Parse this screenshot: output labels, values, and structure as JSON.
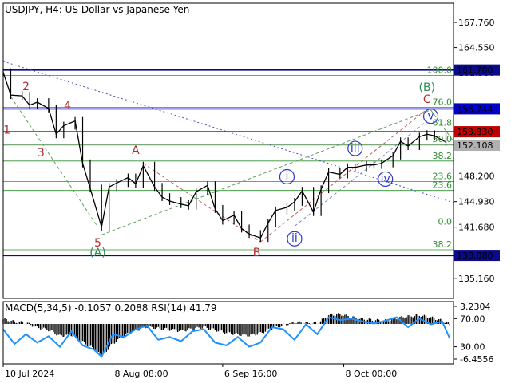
{
  "chart_data": {
    "type": "line",
    "title": "USDJPY, H4:  US Dollar vs Japanese Yen",
    "symbol": "USDJPY",
    "timeframe": "H4",
    "instrument": "US Dollar vs Japanese Yen",
    "price_axis": {
      "ylim": [
        132.6,
        170.2
      ],
      "ticks": [
        "167.760",
        "164.550",
        "161.700",
        "156.744",
        "153.830",
        "152.108",
        "148.200",
        "144.930",
        "141.680",
        "138.080",
        "135.160"
      ],
      "plain_ticks": [
        167.76,
        164.55,
        148.2,
        144.93,
        141.68,
        135.16
      ],
      "hidden_tick": {
        "label": "161.380",
        "value": 161.38
      }
    },
    "x_axis": {
      "labels": [
        "10 Jul 2024",
        "8 Aug 08:00",
        "6 Sep 16:00",
        "8 Oct 00:00"
      ],
      "range": [
        "2024-07-10",
        "2024-11-06"
      ]
    },
    "levels": [
      {
        "value": 161.7,
        "label": "161.700",
        "color": "#0a0a8a",
        "kind": "resistance"
      },
      {
        "value": 156.744,
        "label": "156.744",
        "color": "#0000c8",
        "kind": "level"
      },
      {
        "value": 153.83,
        "label": "153.830",
        "color": "#c00000",
        "kind": "level"
      },
      {
        "value": 152.108,
        "label": "152.108",
        "color": "#b0b0b0",
        "kind": "current"
      },
      {
        "value": 138.08,
        "label": "138.080",
        "color": "#0a0a8a",
        "kind": "support"
      }
    ],
    "fib_levels": [
      {
        "label": "100.0",
        "value": 161.0
      },
      {
        "label": "76.0",
        "value": 156.95
      },
      {
        "label": "61.8",
        "value": 154.3
      },
      {
        "label": "50.0",
        "value": 152.2
      },
      {
        "label": "38.2",
        "value": 150.1
      },
      {
        "label": "23.6",
        "value": 147.5
      },
      {
        "label": "23.6",
        "value": 146.35
      },
      {
        "label": "0.0",
        "value": 141.7
      },
      {
        "label": "38.2",
        "value": 138.8
      }
    ],
    "price_series": [
      {
        "x": "2024-07-10",
        "y": 161.4
      },
      {
        "x": "2024-07-12",
        "y": 158.5
      },
      {
        "x": "2024-07-15",
        "y": 158.4
      },
      {
        "x": "2024-07-17",
        "y": 157.2
      },
      {
        "x": "2024-07-19",
        "y": 157.6
      },
      {
        "x": "2024-07-22",
        "y": 156.8
      },
      {
        "x": "2024-07-24",
        "y": 153.5
      },
      {
        "x": "2024-07-26",
        "y": 154.6
      },
      {
        "x": "2024-07-29",
        "y": 155.2
      },
      {
        "x": "2024-07-31",
        "y": 149.8
      },
      {
        "x": "2024-08-02",
        "y": 146.6
      },
      {
        "x": "2024-08-05",
        "y": 141.7
      },
      {
        "x": "2024-08-07",
        "y": 146.8
      },
      {
        "x": "2024-08-09",
        "y": 147.3
      },
      {
        "x": "2024-08-12",
        "y": 148.0
      },
      {
        "x": "2024-08-14",
        "y": 147.2
      },
      {
        "x": "2024-08-16",
        "y": 149.5
      },
      {
        "x": "2024-08-19",
        "y": 146.8
      },
      {
        "x": "2024-08-21",
        "y": 145.5
      },
      {
        "x": "2024-08-23",
        "y": 145.0
      },
      {
        "x": "2024-08-26",
        "y": 144.6
      },
      {
        "x": "2024-08-28",
        "y": 144.4
      },
      {
        "x": "2024-08-30",
        "y": 146.2
      },
      {
        "x": "2024-09-02",
        "y": 147.0
      },
      {
        "x": "2024-09-04",
        "y": 144.0
      },
      {
        "x": "2024-09-06",
        "y": 142.5
      },
      {
        "x": "2024-09-09",
        "y": 143.2
      },
      {
        "x": "2024-09-11",
        "y": 141.5
      },
      {
        "x": "2024-09-13",
        "y": 140.8
      },
      {
        "x": "2024-09-16",
        "y": 140.3
      },
      {
        "x": "2024-09-18",
        "y": 142.2
      },
      {
        "x": "2024-09-20",
        "y": 143.8
      },
      {
        "x": "2024-09-23",
        "y": 144.2
      },
      {
        "x": "2024-09-25",
        "y": 144.9
      },
      {
        "x": "2024-09-27",
        "y": 146.3
      },
      {
        "x": "2024-09-30",
        "y": 143.6
      },
      {
        "x": "2024-10-02",
        "y": 146.5
      },
      {
        "x": "2024-10-04",
        "y": 148.7
      },
      {
        "x": "2024-10-07",
        "y": 148.4
      },
      {
        "x": "2024-10-09",
        "y": 149.3
      },
      {
        "x": "2024-10-11",
        "y": 149.3
      },
      {
        "x": "2024-10-14",
        "y": 149.6
      },
      {
        "x": "2024-10-16",
        "y": 149.6
      },
      {
        "x": "2024-10-18",
        "y": 149.8
      },
      {
        "x": "2024-10-21",
        "y": 150.8
      },
      {
        "x": "2024-10-23",
        "y": 152.6
      },
      {
        "x": "2024-10-25",
        "y": 152.0
      },
      {
        "x": "2024-10-28",
        "y": 153.2
      },
      {
        "x": "2024-10-30",
        "y": 153.5
      },
      {
        "x": "2024-11-01",
        "y": 153.3
      },
      {
        "x": "2024-11-04",
        "y": 152.5
      }
    ],
    "trend_lines": [
      {
        "style": "dotted",
        "color": "#5050b0",
        "from": {
          "x": "2024-07-10",
          "y": 162.8
        },
        "to": {
          "x": "2024-11-06",
          "y": 144.8
        }
      },
      {
        "style": "dashed",
        "color": "#60a060",
        "from": {
          "x": "2024-07-12",
          "y": 158.3
        },
        "to": {
          "x": "2024-08-04",
          "y": 141.7
        }
      },
      {
        "style": "dashed",
        "color": "#60a060",
        "from": {
          "x": "2024-08-05",
          "y": 140.7
        },
        "to": {
          "x": "2024-10-31",
          "y": 156.6
        }
      },
      {
        "style": "dashed",
        "color": "#60a060",
        "from": {
          "x": "2024-10-31",
          "y": 156.6
        },
        "to": {
          "x": "2024-11-06",
          "y": 152.6
        }
      },
      {
        "style": "dashed",
        "color": "#c06060",
        "from": {
          "x": "2024-08-16",
          "y": 149.8
        },
        "to": {
          "x": "2024-09-16",
          "y": 139.8
        }
      },
      {
        "style": "dashed",
        "color": "#c06060",
        "from": {
          "x": "2024-09-16",
          "y": 139.8
        },
        "to": {
          "x": "2024-10-30",
          "y": 156.7
        }
      },
      {
        "style": "dashed",
        "color": "#8080c8",
        "from": {
          "x": "2024-09-25",
          "y": 141.8
        },
        "to": {
          "x": "2024-10-30",
          "y": 155.2
        }
      }
    ],
    "wave_labels": [
      {
        "text": "1",
        "style": "plain",
        "color": "#b03030",
        "x": "2024-07-11",
        "y": 153.6
      },
      {
        "text": "2",
        "style": "plain",
        "color": "#b03030",
        "x": "2024-07-16",
        "y": 159.1
      },
      {
        "text": "3",
        "style": "plain",
        "color": "#b03030",
        "x": "2024-07-20",
        "y": 150.7
      },
      {
        "text": "4",
        "style": "plain",
        "color": "#b03030",
        "x": "2024-07-27",
        "y": 156.7
      },
      {
        "text": "5",
        "style": "plain",
        "color": "#b03030",
        "x": "2024-08-04",
        "y": 139.2
      },
      {
        "text": "A",
        "style": "plain",
        "color": "#b03030",
        "x": "2024-08-14",
        "y": 151.0
      },
      {
        "text": "B",
        "style": "plain",
        "color": "#b03030",
        "x": "2024-09-15",
        "y": 138.0
      },
      {
        "text": "C",
        "style": "plain",
        "color": "#b03030",
        "x": "2024-10-30",
        "y": 157.5
      },
      {
        "text": "(A)",
        "style": "plain",
        "color": "#2e8b57",
        "x": "2024-08-04",
        "y": 138.0
      },
      {
        "text": "(B)",
        "style": "plain",
        "color": "#2e8b57",
        "x": "2024-10-30",
        "y": 159.0
      },
      {
        "text": "i",
        "style": "circled",
        "color": "#2a3ac8",
        "x": "2024-09-23",
        "y": 148.1
      },
      {
        "text": "ii",
        "style": "circled",
        "color": "#2a3ac8",
        "x": "2024-09-25",
        "y": 140.2
      },
      {
        "text": "iii",
        "style": "circled",
        "color": "#2a3ac8",
        "x": "2024-10-11",
        "y": 151.7
      },
      {
        "text": "iv",
        "style": "circled",
        "color": "#2a3ac8",
        "x": "2024-10-19",
        "y": 147.8
      },
      {
        "text": "v",
        "style": "circled",
        "color": "#2a3ac8",
        "x": "2024-10-31",
        "y": 155.8
      }
    ],
    "indicator": {
      "header": "MACD(5,34,5) -0.1057 0.2088 RSI(14) 41.79",
      "ticks": [
        {
          "label": "3.2304",
          "value": 3.2304,
          "scale": "macd"
        },
        {
          "label": "70.00",
          "value": 70,
          "scale": "rsi"
        },
        {
          "label": "30.00",
          "value": 30,
          "scale": "rsi"
        },
        {
          "label": "-6.4556",
          "value": -6.4556,
          "scale": "macd"
        }
      ],
      "macd_range": [
        -6.4556,
        3.2304
      ],
      "rsi_range": [
        8,
        92
      ],
      "macd_series": [
        {
          "x": "2024-07-10",
          "y": 0.9
        },
        {
          "x": "2024-07-13",
          "y": 0.4
        },
        {
          "x": "2024-07-16",
          "y": 0.2
        },
        {
          "x": "2024-07-19",
          "y": -0.6
        },
        {
          "x": "2024-07-22",
          "y": -1.1
        },
        {
          "x": "2024-07-25",
          "y": -2.2
        },
        {
          "x": "2024-07-28",
          "y": -2.0
        },
        {
          "x": "2024-07-31",
          "y": -3.3
        },
        {
          "x": "2024-08-03",
          "y": -4.6
        },
        {
          "x": "2024-08-05",
          "y": -5.9
        },
        {
          "x": "2024-08-08",
          "y": -3.6
        },
        {
          "x": "2024-08-11",
          "y": -2.1
        },
        {
          "x": "2024-08-14",
          "y": -1.2
        },
        {
          "x": "2024-08-17",
          "y": -0.5
        },
        {
          "x": "2024-08-20",
          "y": -0.8
        },
        {
          "x": "2024-08-23",
          "y": -1.0
        },
        {
          "x": "2024-08-26",
          "y": -1.3
        },
        {
          "x": "2024-08-29",
          "y": -0.9
        },
        {
          "x": "2024-09-01",
          "y": -0.6
        },
        {
          "x": "2024-09-04",
          "y": -1.1
        },
        {
          "x": "2024-09-07",
          "y": -1.6
        },
        {
          "x": "2024-09-10",
          "y": -1.9
        },
        {
          "x": "2024-09-13",
          "y": -2.1
        },
        {
          "x": "2024-09-16",
          "y": -1.7
        },
        {
          "x": "2024-09-19",
          "y": -0.8
        },
        {
          "x": "2024-09-22",
          "y": -0.2
        },
        {
          "x": "2024-09-25",
          "y": 0.3
        },
        {
          "x": "2024-09-28",
          "y": 0.2
        },
        {
          "x": "2024-10-01",
          "y": 0.1
        },
        {
          "x": "2024-10-04",
          "y": 1.6
        },
        {
          "x": "2024-10-07",
          "y": 1.8
        },
        {
          "x": "2024-10-10",
          "y": 1.3
        },
        {
          "x": "2024-10-13",
          "y": 0.9
        },
        {
          "x": "2024-10-16",
          "y": 0.7
        },
        {
          "x": "2024-10-19",
          "y": 0.6
        },
        {
          "x": "2024-10-22",
          "y": 1.1
        },
        {
          "x": "2024-10-25",
          "y": 1.4
        },
        {
          "x": "2024-10-28",
          "y": 1.6
        },
        {
          "x": "2024-10-31",
          "y": 1.2
        },
        {
          "x": "2024-11-03",
          "y": 0.6
        },
        {
          "x": "2024-11-05",
          "y": -0.1
        }
      ],
      "rsi_series": [
        {
          "x": "2024-07-10",
          "y": 55
        },
        {
          "x": "2024-07-13",
          "y": 34
        },
        {
          "x": "2024-07-16",
          "y": 48
        },
        {
          "x": "2024-07-19",
          "y": 36
        },
        {
          "x": "2024-07-22",
          "y": 45
        },
        {
          "x": "2024-07-25",
          "y": 30
        },
        {
          "x": "2024-07-28",
          "y": 52
        },
        {
          "x": "2024-07-31",
          "y": 32
        },
        {
          "x": "2024-08-03",
          "y": 26
        },
        {
          "x": "2024-08-05",
          "y": 16
        },
        {
          "x": "2024-08-08",
          "y": 48
        },
        {
          "x": "2024-08-11",
          "y": 44
        },
        {
          "x": "2024-08-14",
          "y": 55
        },
        {
          "x": "2024-08-17",
          "y": 60
        },
        {
          "x": "2024-08-20",
          "y": 40
        },
        {
          "x": "2024-08-23",
          "y": 44
        },
        {
          "x": "2024-08-26",
          "y": 38
        },
        {
          "x": "2024-08-29",
          "y": 52
        },
        {
          "x": "2024-09-01",
          "y": 55
        },
        {
          "x": "2024-09-04",
          "y": 36
        },
        {
          "x": "2024-09-07",
          "y": 32
        },
        {
          "x": "2024-09-10",
          "y": 44
        },
        {
          "x": "2024-09-13",
          "y": 30
        },
        {
          "x": "2024-09-16",
          "y": 36
        },
        {
          "x": "2024-09-19",
          "y": 58
        },
        {
          "x": "2024-09-22",
          "y": 55
        },
        {
          "x": "2024-09-25",
          "y": 40
        },
        {
          "x": "2024-09-28",
          "y": 62
        },
        {
          "x": "2024-10-01",
          "y": 48
        },
        {
          "x": "2024-10-04",
          "y": 72
        },
        {
          "x": "2024-10-07",
          "y": 68
        },
        {
          "x": "2024-10-10",
          "y": 70
        },
        {
          "x": "2024-10-13",
          "y": 66
        },
        {
          "x": "2024-10-16",
          "y": 63
        },
        {
          "x": "2024-10-19",
          "y": 67
        },
        {
          "x": "2024-10-22",
          "y": 72
        },
        {
          "x": "2024-10-25",
          "y": 58
        },
        {
          "x": "2024-10-28",
          "y": 70
        },
        {
          "x": "2024-10-31",
          "y": 62
        },
        {
          "x": "2024-11-03",
          "y": 66
        },
        {
          "x": "2024-11-05",
          "y": 42
        }
      ]
    }
  }
}
